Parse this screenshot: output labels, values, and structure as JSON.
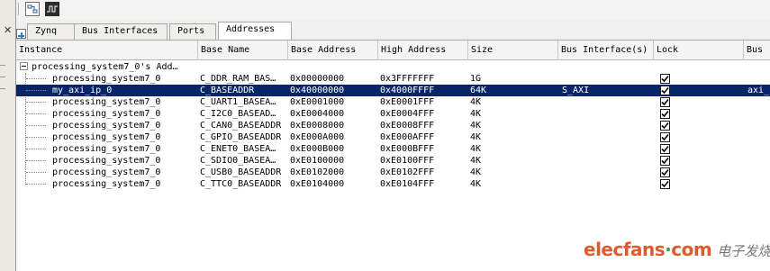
{
  "tabs": [
    {
      "label": "Zynq",
      "active": false
    },
    {
      "label": "Bus Interfaces",
      "active": false
    },
    {
      "label": "Ports",
      "active": false
    },
    {
      "label": "Addresses",
      "active": true
    }
  ],
  "columns": [
    "Instance",
    "Base Name",
    "Base Address",
    "High Address",
    "Size",
    "Bus Interface(s)",
    "Lock",
    "Bus"
  ],
  "root": {
    "label": "processing_system7_0's Add…",
    "expanded": true
  },
  "rows": [
    {
      "instance": "processing_system7_0",
      "base_name": "C_DDR_RAM_BAS…",
      "base_addr": "0x00000000",
      "high_addr": "0x3FFFFFFF",
      "size": "1G",
      "bus_if": "",
      "lock": true,
      "bus": "",
      "selected": false
    },
    {
      "instance": "my_axi_ip_0",
      "base_name": "C_BASEADDR",
      "base_addr": "0x40000000",
      "high_addr": "0x4000FFFF",
      "size": "64K",
      "bus_if": "S_AXI",
      "lock": true,
      "bus": "axi_i",
      "selected": true
    },
    {
      "instance": "processing_system7_0",
      "base_name": "C_UART1_BASEA…",
      "base_addr": "0xE0001000",
      "high_addr": "0xE0001FFF",
      "size": "4K",
      "bus_if": "",
      "lock": true,
      "bus": "",
      "selected": false
    },
    {
      "instance": "processing_system7_0",
      "base_name": "C_I2C0_BASEAD…",
      "base_addr": "0xE0004000",
      "high_addr": "0xE0004FFF",
      "size": "4K",
      "bus_if": "",
      "lock": true,
      "bus": "",
      "selected": false
    },
    {
      "instance": "processing_system7_0",
      "base_name": "C_CAN0_BASEADDR",
      "base_addr": "0xE0008000",
      "high_addr": "0xE0008FFF",
      "size": "4K",
      "bus_if": "",
      "lock": true,
      "bus": "",
      "selected": false
    },
    {
      "instance": "processing_system7_0",
      "base_name": "C_GPIO_BASEADDR",
      "base_addr": "0xE000A000",
      "high_addr": "0xE000AFFF",
      "size": "4K",
      "bus_if": "",
      "lock": true,
      "bus": "",
      "selected": false
    },
    {
      "instance": "processing_system7_0",
      "base_name": "C_ENET0_BASEA…",
      "base_addr": "0xE000B000",
      "high_addr": "0xE000BFFF",
      "size": "4K",
      "bus_if": "",
      "lock": true,
      "bus": "",
      "selected": false
    },
    {
      "instance": "processing_system7_0",
      "base_name": "C_SDIO0_BASEA…",
      "base_addr": "0xE0100000",
      "high_addr": "0xE0100FFF",
      "size": "4K",
      "bus_if": "",
      "lock": true,
      "bus": "",
      "selected": false
    },
    {
      "instance": "processing_system7_0",
      "base_name": "C_USB0_BASEADDR",
      "base_addr": "0xE0102000",
      "high_addr": "0xE0102FFF",
      "size": "4K",
      "bus_if": "",
      "lock": true,
      "bus": "",
      "selected": false
    },
    {
      "instance": "processing_system7_0",
      "base_name": "C_TTC0_BASEADDR",
      "base_addr": "0xE0104000",
      "high_addr": "0xE0104FFF",
      "size": "4K",
      "bus_if": "",
      "lock": true,
      "bus": "",
      "selected": false
    }
  ],
  "watermark": {
    "logo_main": "elecfans",
    "logo_dot": "·",
    "logo_tld": "com",
    "cn_text": "电子发烧友"
  },
  "icons": {
    "toolbar_1": "block-diagram-icon",
    "toolbar_2": "waveform-icon",
    "add": "add-icon",
    "close": "close-icon"
  },
  "colors": {
    "selection": "#0a246a",
    "watermark_orange": "#e05a2d",
    "watermark_green": "#3aa23a"
  }
}
